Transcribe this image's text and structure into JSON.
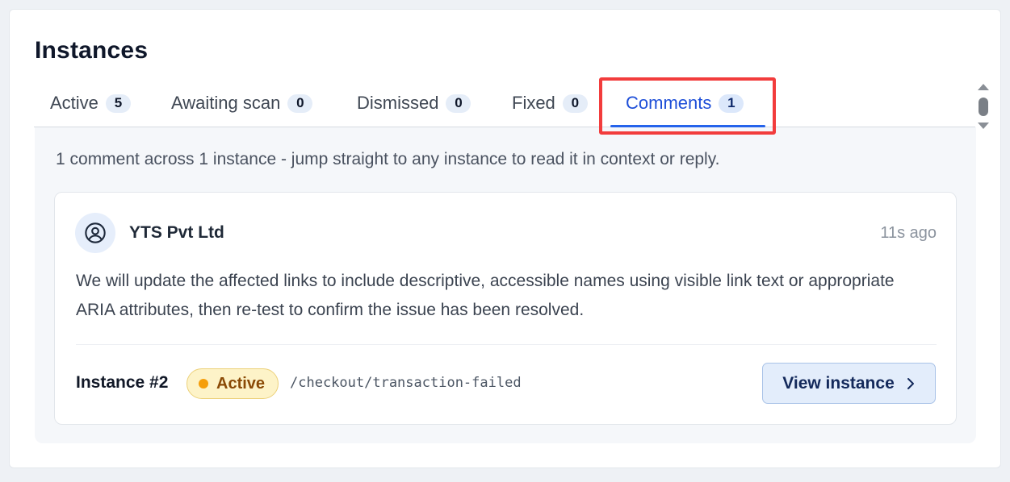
{
  "page": {
    "title": "Instances"
  },
  "tabs": [
    {
      "label": "Active",
      "count": "5"
    },
    {
      "label": "Awaiting scan",
      "count": "0"
    },
    {
      "label": "Dismissed",
      "count": "0"
    },
    {
      "label": "Fixed",
      "count": "0"
    },
    {
      "label": "Comments",
      "count": "1",
      "selected": true
    }
  ],
  "summary": "1 comment across 1 instance - jump straight to any instance to read it in context or reply.",
  "comment": {
    "author": "YTS Pvt Ltd",
    "time": "11s ago",
    "avatar_icon": "user-circle-icon",
    "text": "We will update the affected links to include descriptive, accessible names using visible link text or appropriate ARIA attributes, then re-test to confirm the issue has been resolved.",
    "instance_label": "Instance #2",
    "status": "Active",
    "path": "/checkout/transaction-failed",
    "view_label": "View instance"
  },
  "colors": {
    "accent": "#2563eb",
    "highlight": "#f23c3c",
    "status_active": "#f59e0b"
  }
}
